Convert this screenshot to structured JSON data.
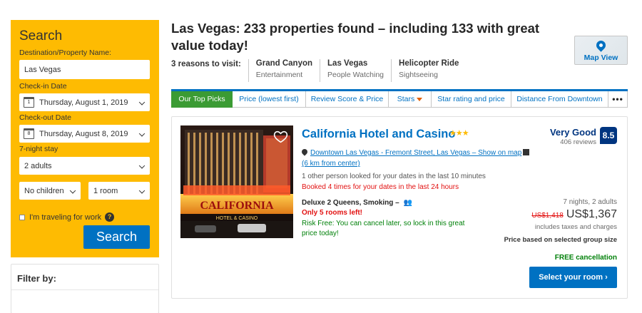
{
  "search": {
    "title": "Search",
    "destination_label": "Destination/Property Name:",
    "destination_value": "Las Vegas",
    "checkin_label": "Check-in Date",
    "checkin_value": "Thursday, August 1, 2019",
    "checkin_icon_day": "1",
    "checkout_label": "Check-out Date",
    "checkout_value": "Thursday, August 8, 2019",
    "checkout_icon_day": "8",
    "stay_length": "7-night stay",
    "guests_value": "2 adults",
    "children_value": "No children",
    "rooms_value": "1 room",
    "work_travel_label": "I'm traveling for work",
    "help_icon_glyph": "?",
    "search_button": "Search",
    "accent_color": "#febb02"
  },
  "filter": {
    "title": "Filter by:"
  },
  "header": {
    "title": "Las Vegas: 233 properties found – including 133 with great value today!",
    "map_view_label": "Map View",
    "reasons_label": "3 reasons to visit:",
    "reasons": [
      {
        "title": "Grand Canyon",
        "subtitle": "Entertainment"
      },
      {
        "title": "Las Vegas",
        "subtitle": "People Watching"
      },
      {
        "title": "Helicopter Ride",
        "subtitle": "Sightseeing"
      }
    ]
  },
  "sort_tabs": [
    {
      "label": "Our Top Picks",
      "active": true
    },
    {
      "label": "Price (lowest first)",
      "active": false
    },
    {
      "label": "Review Score & Price",
      "active": false
    },
    {
      "label": "Stars",
      "active": false
    },
    {
      "label": "Star rating and price",
      "active": false
    },
    {
      "label": "Distance From Downtown",
      "active": false
    },
    {
      "label": "•••",
      "active": false
    }
  ],
  "property": {
    "name": "California Hotel and Casino",
    "stars_glyph": "★★★",
    "stars": 3,
    "location_link": "Downtown Las Vegas - Fremont Street, Las Vegas – Show on map",
    "distance": "(6 km from center)",
    "looked_text": "1 other person looked for your dates in the last 10 minutes",
    "booked_text": "Booked 4 times for your dates in the last 24 hours",
    "room_type": "Deluxe 2 Queens, Smoking –",
    "occupancy_icon": "👥",
    "rooms_left": "Only 5 rooms left!",
    "risk_free": "Risk Free: You can cancel later, so lock in this great price today!",
    "score_word": "Very Good",
    "reviews": "406 reviews",
    "score": "8.5",
    "stay_info": "7 nights, 2 adults",
    "old_price": "US$1,418",
    "new_price": "US$1,367",
    "taxes": "includes taxes and charges",
    "group_note": "Price based on selected group size",
    "free_cancellation": "FREE cancellation",
    "select_button": "Select your room ›",
    "sign_text": "CALIFORNIA",
    "sign_sub": "HOTEL & CASINO"
  }
}
